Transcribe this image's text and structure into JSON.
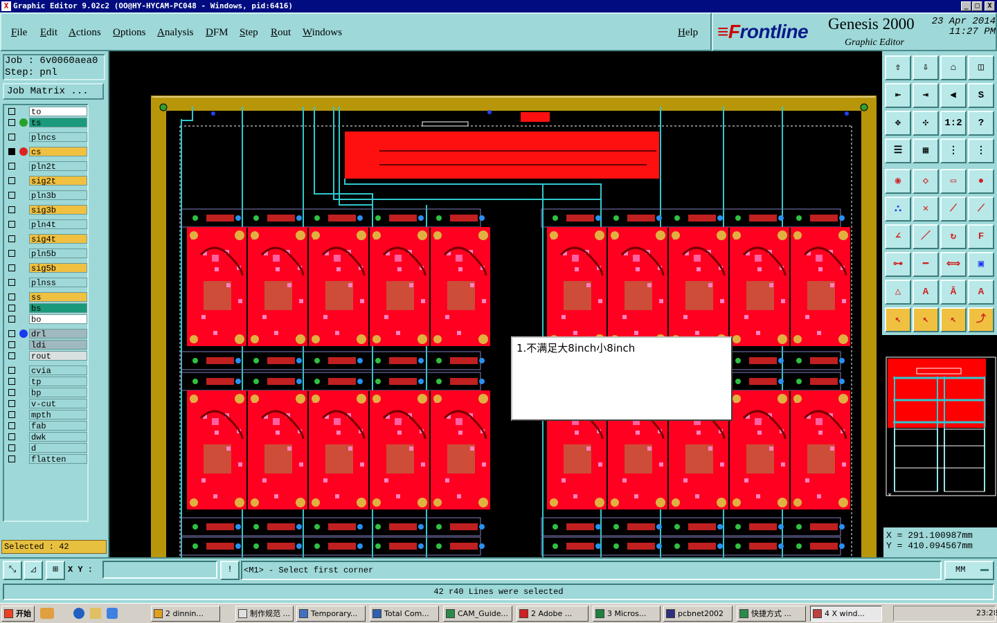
{
  "window": {
    "title": "Graphic Editor 9.02c2  (OO@HY-HYCAM-PC048 - Windows, pid:6416)",
    "controls": [
      "_",
      "□",
      "X"
    ]
  },
  "menu": [
    "File",
    "Edit",
    "Actions",
    "Options",
    "Analysis",
    "DFM",
    "Step",
    "Rout",
    "Windows"
  ],
  "help_label": "Help",
  "brand": {
    "logo_prefix": "≡F",
    "logo_rest": "rontline",
    "product": "Genesis 2000",
    "subtitle": "Graphic Editor",
    "date": "23 Apr 2014",
    "time": "11:27 PM"
  },
  "job": {
    "job_label": "Job : ",
    "job": "6v0060aea0",
    "step_label": "Step: ",
    "step": "pnl"
  },
  "job_matrix_label": "Job Matrix ...",
  "layers": [
    {
      "name": "to",
      "color": "#ffffff",
      "checked": false
    },
    {
      "name": "ts",
      "color": "#1a9a7a",
      "checked": false,
      "mark": "#2aa02a"
    },
    {
      "name": "plncs",
      "color": "#9ed8d8",
      "checked": false
    },
    {
      "name": "cs",
      "color": "#f0c040",
      "checked": true,
      "mark": "#e02020"
    },
    {
      "name": "pln2t",
      "color": "#9ed8d8",
      "checked": false
    },
    {
      "name": "sig2t",
      "color": "#f0c040",
      "checked": false
    },
    {
      "name": "pln3b",
      "color": "#9ed8d8",
      "checked": false
    },
    {
      "name": "sig3b",
      "color": "#f0c040",
      "checked": false
    },
    {
      "name": "pln4t",
      "color": "#9ed8d8",
      "checked": false
    },
    {
      "name": "sig4t",
      "color": "#f0c040",
      "checked": false
    },
    {
      "name": "pln5b",
      "color": "#9ed8d8",
      "checked": false
    },
    {
      "name": "sig5b",
      "color": "#f0c040",
      "checked": false
    },
    {
      "name": "plnss",
      "color": "#9ed8d8",
      "checked": false
    },
    {
      "name": "ss",
      "color": "#f0c040",
      "checked": false
    },
    {
      "name": "bs",
      "color": "#1a9a7a",
      "checked": false
    },
    {
      "name": "bo",
      "color": "#ffffff",
      "checked": false
    },
    {
      "name": "drl",
      "color": "#a0b8c0",
      "checked": false,
      "mark": "#1a3af0"
    },
    {
      "name": "ldi",
      "color": "#a0b8c0",
      "checked": false
    },
    {
      "name": "rout",
      "color": "#d8e0e0",
      "checked": false
    },
    {
      "name": "cvia",
      "color": "#9ed8d8",
      "checked": false
    },
    {
      "name": "tp",
      "color": "#9ed8d8",
      "checked": false
    },
    {
      "name": "bp",
      "color": "#9ed8d8",
      "checked": false
    },
    {
      "name": "v-cut",
      "color": "#9ed8d8",
      "checked": false
    },
    {
      "name": "mpth",
      "color": "#9ed8d8",
      "checked": false
    },
    {
      "name": "fab",
      "color": "#9ed8d8",
      "checked": false
    },
    {
      "name": "dwk",
      "color": "#9ed8d8",
      "checked": false
    },
    {
      "name": "d",
      "color": "#9ed8d8",
      "checked": false
    },
    {
      "name": "flatten",
      "color": "#9ed8d8",
      "checked": false
    }
  ],
  "selected_text": "Selected : 42",
  "popup_text": "1.不满足大8inch小8inch",
  "coords": {
    "x_label": "X  = ",
    "x": "291.100987mm",
    "y_label": "Y  = ",
    "y": "410.094567mm"
  },
  "xy_label": "X Y :",
  "xy_value": "",
  "message": "<M1> - Select first corner",
  "units": "MM",
  "status_text": "42 r40 Lines were selected",
  "taskbar": {
    "start": "开始",
    "items": [
      "2 dinnin...",
      "制作规范 ...",
      "Temporary...",
      "Total Com...",
      "CAM_Guide...",
      "2 Adobe ...",
      "3 Micros...",
      "pcbnet2002",
      "快捷方式 ...",
      "4 X wind..."
    ],
    "clock": "23:28"
  },
  "icons": {
    "toolbar": [
      "export-icon",
      "import-icon",
      "home-icon",
      "split-window-icon",
      "left-arrow-icon",
      "right-arrow-icon",
      "mirror-icon",
      "s-curve-icon",
      "fit-icon",
      "pan-icon",
      "one-to-one-icon",
      "help-icon",
      "list-icon",
      "grid-icon",
      "layers-icon",
      "layers-active-icon",
      "snapshot-icon",
      "eraser-icon",
      "ruler-icon",
      "dot-icon",
      "connect-icon",
      "cross-icon",
      "line-icon",
      "line-alt-icon",
      "angle-icon",
      "slash-icon",
      "arc-icon",
      "text-icon",
      "move-icon",
      "minus-icon",
      "resize-icon",
      "group-icon",
      "triangle-icon",
      "a-icon",
      "a-box-icon",
      "a-alt-icon",
      "pointer-icon",
      "pointer-box-icon",
      "pointer-select-icon",
      "route-icon"
    ]
  }
}
